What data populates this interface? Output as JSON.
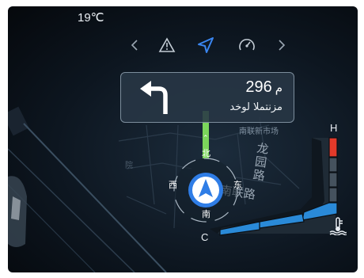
{
  "status": {
    "temperature": "19℃"
  },
  "mode_bar": {
    "icons": [
      "chevron-left-icon",
      "warning-icon",
      "navigation-icon",
      "speedometer-icon",
      "chevron-right-icon"
    ],
    "active": "navigation-icon"
  },
  "navigation": {
    "maneuver_icon": "turn-left-arrow-icon",
    "distance_value": "296",
    "distance_unit": "م",
    "street_name": "مزنتملا لوخد"
  },
  "map": {
    "labels": [
      "南联新市场",
      "龙园路",
      "南联路",
      "院"
    ],
    "route_marker": "⌃"
  },
  "compass": {
    "north": "北",
    "south": "南",
    "east": "东",
    "west": "西"
  },
  "fuel_gauge": {
    "high_label": "H",
    "low_label": "C",
    "coolant_icon": "coolant-temperature-icon",
    "colors": {
      "low": "#2a8ad8",
      "high": "#e23a2a"
    }
  },
  "colors": {
    "accent": "#3a86f0",
    "route": "#6ad04a"
  }
}
